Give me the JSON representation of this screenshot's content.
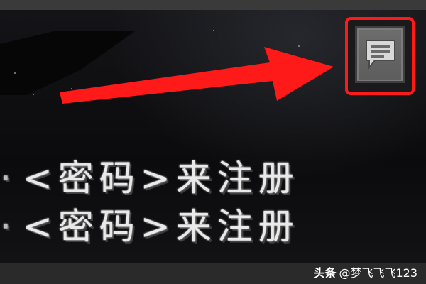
{
  "chat_line_1": "<密码>来注册",
  "chat_line_2": "<密码>来注册",
  "line_lead": "·",
  "watermark": {
    "brand": "头条",
    "author": "@梦飞飞飞123"
  },
  "icons": {
    "chat_button": "chat-bubble-icon",
    "annotation": "red-arrow"
  },
  "colors": {
    "highlight": "#ff1a1a",
    "button_face": "#6e6e6e",
    "text": "#e9e9e9"
  }
}
